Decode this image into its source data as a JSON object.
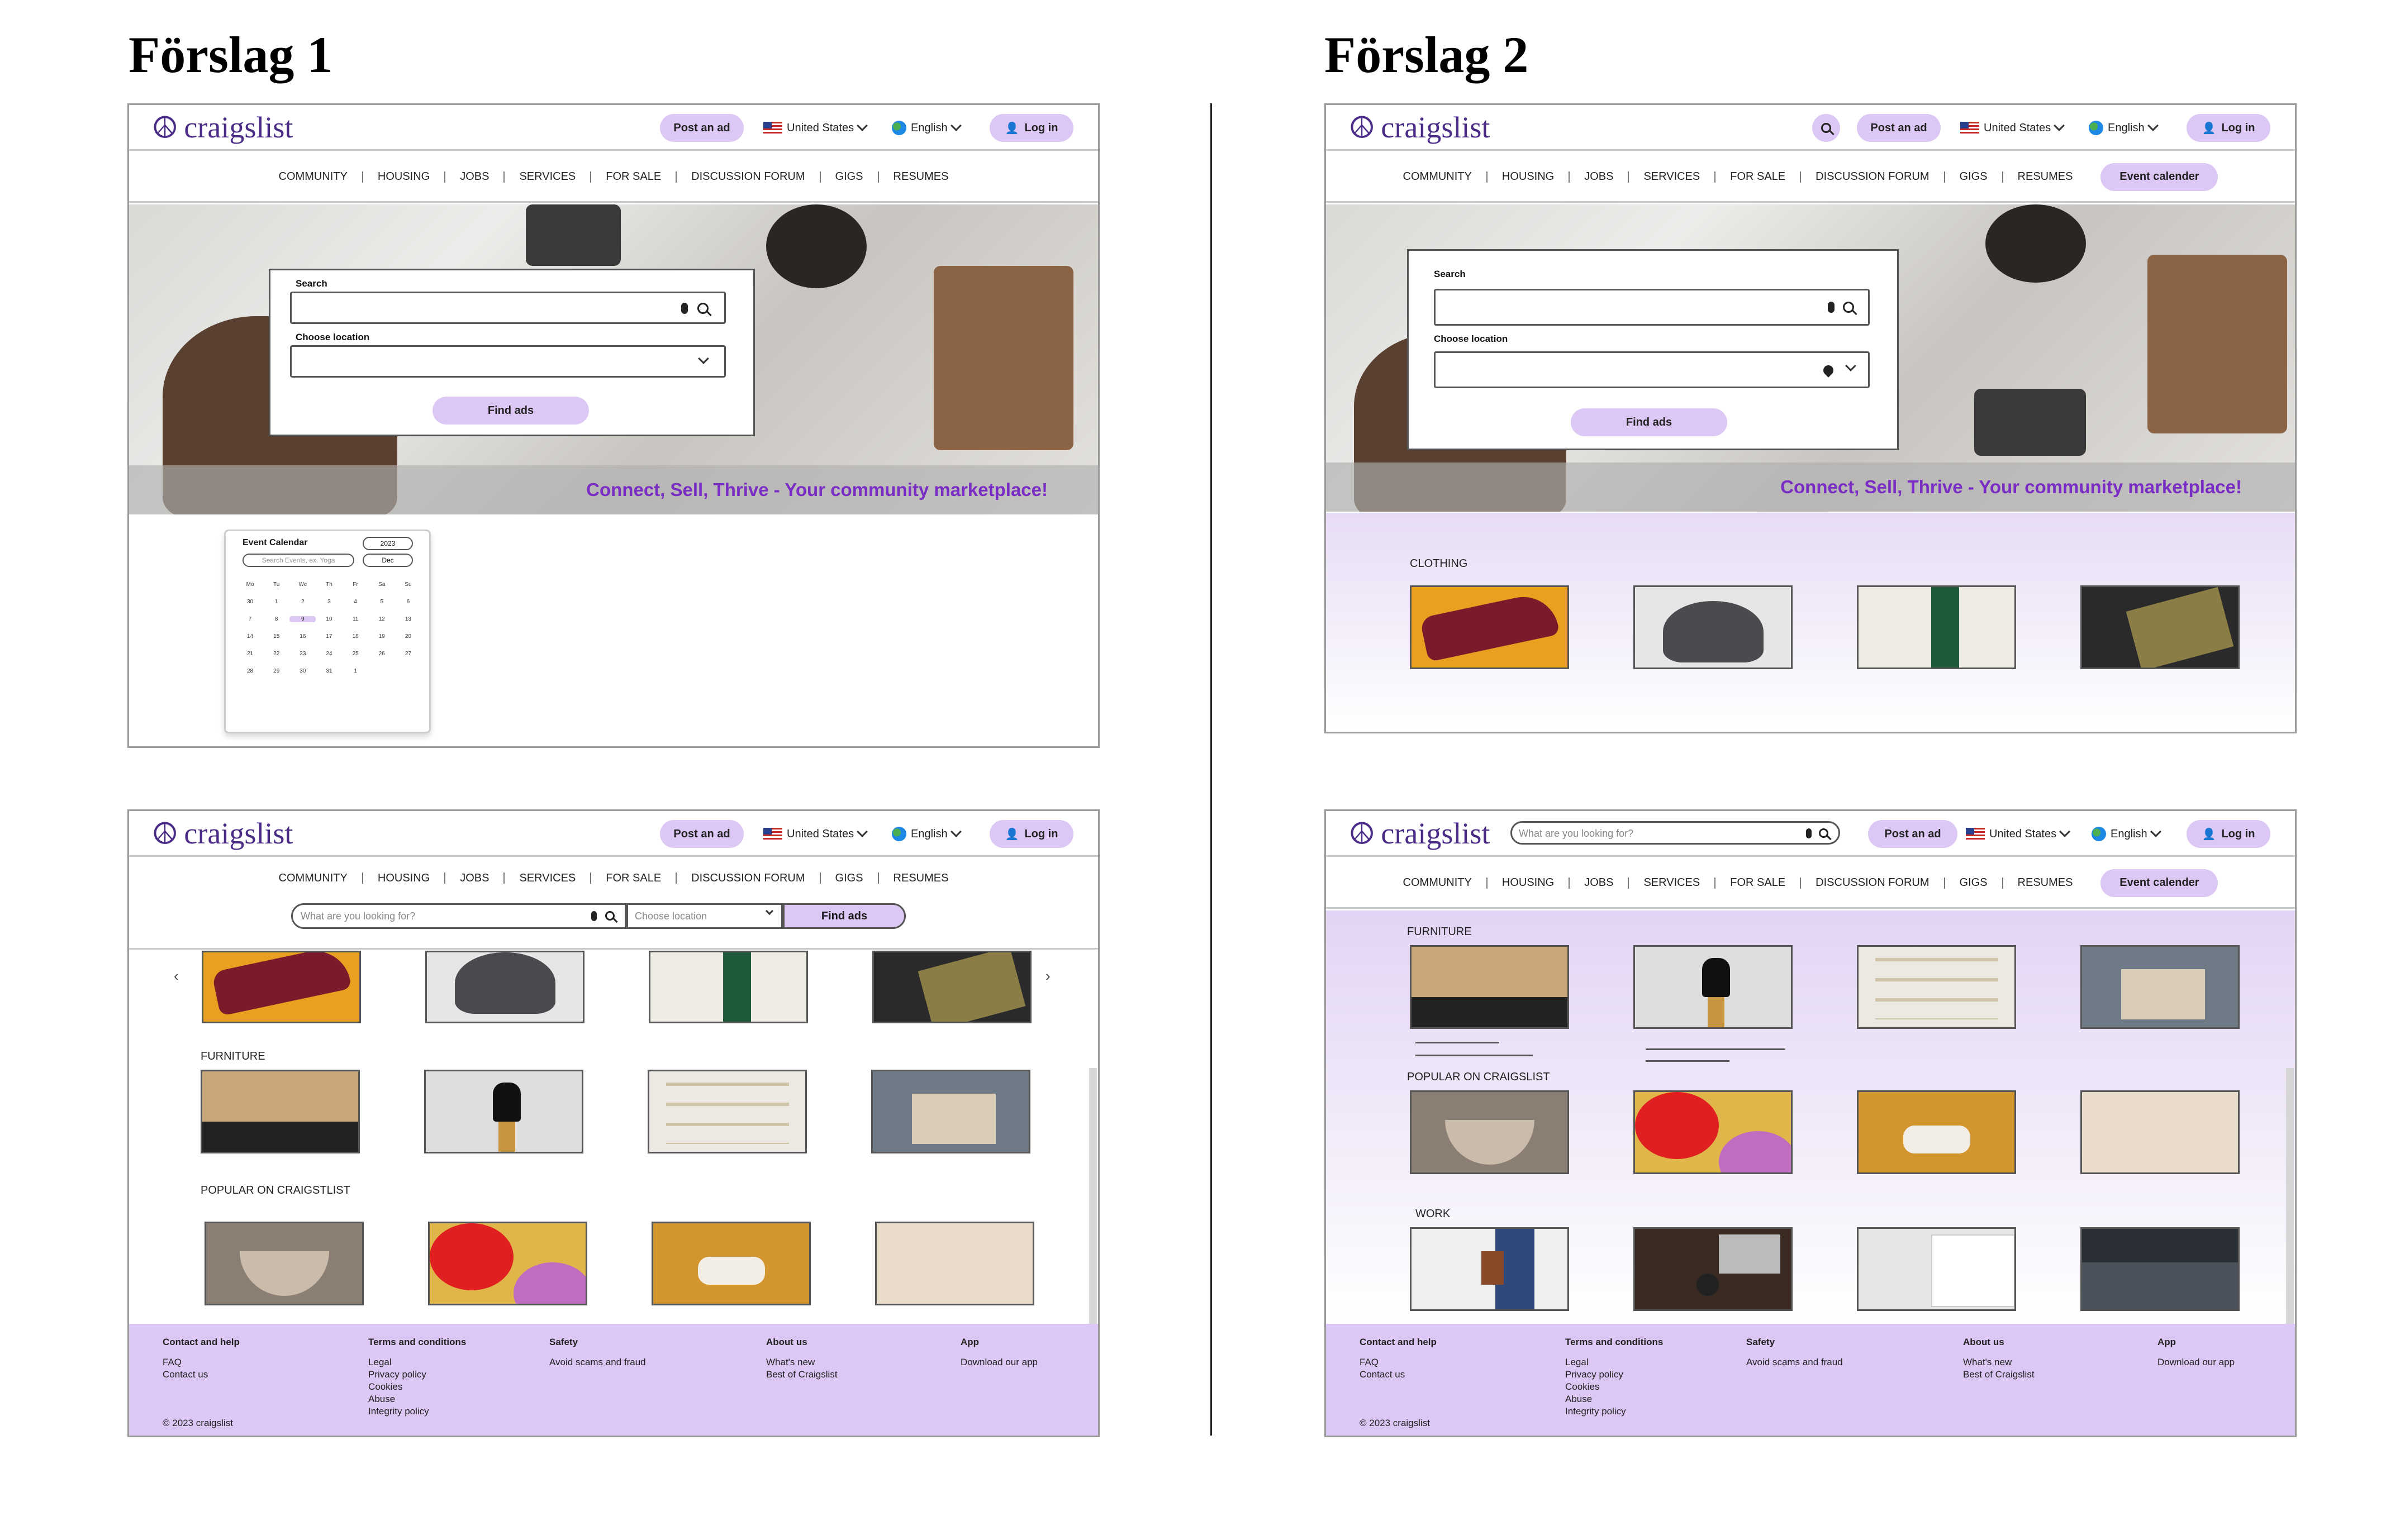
{
  "headings": {
    "left": "Förslag 1",
    "right": "Förslag 2"
  },
  "brand": "craigslist",
  "actions": {
    "post_ad": "Post an ad",
    "country": "United States",
    "language": "English",
    "login": "Log in",
    "event_calendar": "Event calender"
  },
  "nav_items": [
    "COMMUNITY",
    "HOUSING",
    "JOBS",
    "SERVICES",
    "FOR SALE",
    "DISCUSSION FORUM",
    "GIGS",
    "RESUMES"
  ],
  "search": {
    "label": "Search",
    "location_label": "Choose location",
    "button": "Find ads",
    "placeholder": "What are you looking for?",
    "location_placeholder": "Choose location"
  },
  "hero_tagline": "Connect, Sell, Thrive - Your community marketplace!",
  "calendar": {
    "title": "Event Calendar",
    "year": "2023",
    "month": "Dec",
    "search_placeholder": "Search Events, ex. Yoga",
    "weekdays": [
      "Mo",
      "Tu",
      "We",
      "Th",
      "Fr",
      "Sa",
      "Su"
    ],
    "days": [
      "30",
      "1",
      "2",
      "3",
      "4",
      "5",
      "6",
      "7",
      "8",
      "9",
      "10",
      "11",
      "12",
      "13",
      "14",
      "15",
      "16",
      "17",
      "18",
      "19",
      "20",
      "21",
      "22",
      "23",
      "24",
      "25",
      "26",
      "27",
      "28",
      "29",
      "30",
      "31",
      "1"
    ],
    "selected": "9"
  },
  "sections": {
    "clothing": "CLOTHING",
    "furniture": "FURNITURE",
    "popular": "POPULAR ON CRAIGSTLIST",
    "popular2": "POPULAR ON CRAIGSLIST",
    "work": "WORK"
  },
  "footer": {
    "contact": {
      "title": "Contact and help",
      "links": [
        "FAQ",
        "Contact us"
      ]
    },
    "terms": {
      "title": "Terms and conditions",
      "links": [
        "Legal",
        "Privacy policy",
        "Cookies",
        "Abuse",
        "Integrity policy"
      ]
    },
    "safety": {
      "title": "Safety",
      "links": [
        "Avoid scams and fraud"
      ]
    },
    "about": {
      "title": "About us",
      "links": [
        "What's new",
        "Best of Craigslist"
      ]
    },
    "app": {
      "title": "App",
      "links": [
        "Download our app"
      ]
    },
    "copyright": "© 2023 craigslist"
  },
  "colors": {
    "accent": "#dcc7f5",
    "brand": "#4a2c87",
    "tagline": "#7a2dc4"
  },
  "icons": [
    "peace-icon",
    "search-icon",
    "mic-icon",
    "user-icon",
    "chevron-down-icon",
    "location-pin-icon",
    "flag-icon",
    "globe-icon"
  ]
}
